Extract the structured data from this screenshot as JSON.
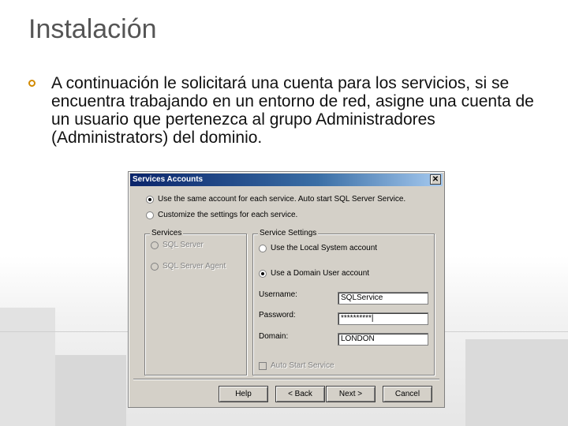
{
  "slide": {
    "title": "Instalación",
    "bullet": "A continuación le solicitará una cuenta para los servicios, si se encuentra trabajando en un entorno de red, asigne una cuenta de un usuario que pertenezca al grupo Administradores (Administrators) del dominio."
  },
  "dialog": {
    "title": "Services Accounts",
    "close": "✕",
    "opt_same": "Use the same account for each service. Auto start SQL Server Service.",
    "opt_custom": "Customize the settings for each service.",
    "services_group": "Services",
    "svc_sql": "SQL Server",
    "svc_agent": "SQL Server Agent",
    "settings_group": "Service Settings",
    "opt_local": "Use the Local System account",
    "opt_domain": "Use a Domain User account",
    "username_label": "Username:",
    "username_value": "SQLService",
    "password_label": "Password:",
    "password_value": "**********|",
    "domain_label": "Domain:",
    "domain_value": "LONDON",
    "autostart": "Auto Start Service",
    "buttons": {
      "help": "Help",
      "back": "< Back",
      "next": "Next >",
      "cancel": "Cancel"
    }
  },
  "colors": {
    "bullet": "#d28a00",
    "title_text": "#555555",
    "titlebar": "#0a246a"
  }
}
